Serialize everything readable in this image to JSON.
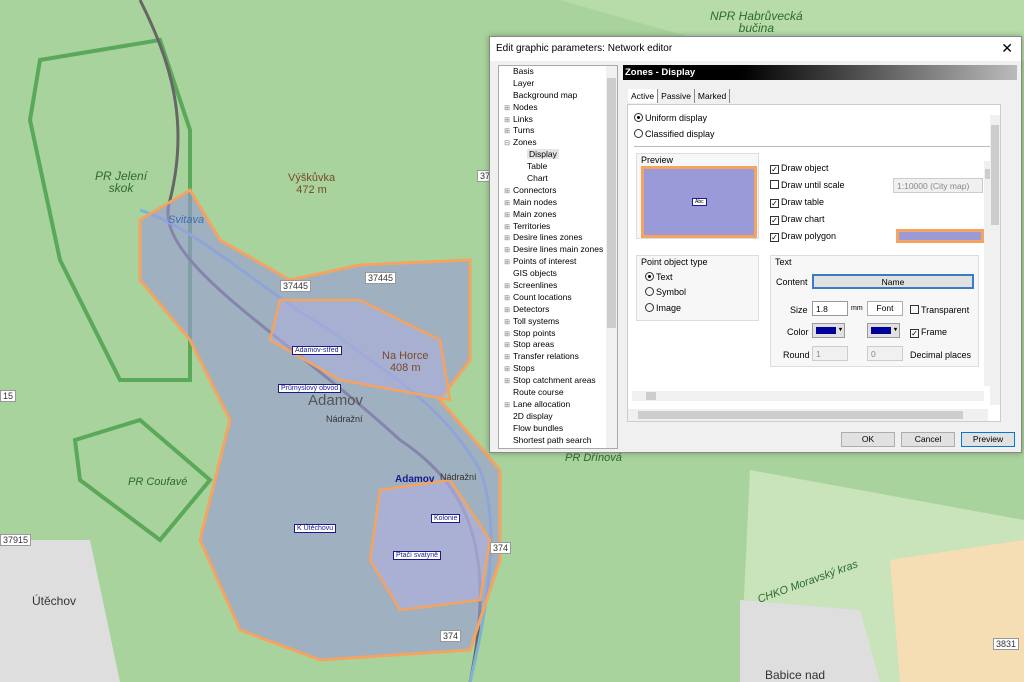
{
  "map": {
    "labels": {
      "npr": "NPR Habrůvecká",
      "npr2": "bučina",
      "jeleni": "PR Jelení",
      "jeleni2": "skok",
      "vyskuvka": "Výškůvka",
      "vyskuvka_h": "472 m",
      "svitava": "Svitava",
      "nahorce": "Na Horce",
      "nahorce_h": "408 m",
      "adamov_big": "Adamov",
      "nadrazni": "Nádražní",
      "nadrazni2": "Nádražní",
      "coufave": "PR Coufavé",
      "adamov2": "Adamov",
      "drinova": "PR Dřínová",
      "chko": "CHKO Moravský kras",
      "utechov": "Útěchov",
      "babice": "Babice nad"
    },
    "roads": {
      "r1": "37445",
      "r2": "37445",
      "r3": "374",
      "r4": "374",
      "r5": "37915",
      "r6": "3831",
      "r7": "15",
      "r8": "37"
    },
    "zones": {
      "z1": "Adamov-střed",
      "z2": "Průmyslový obvod",
      "z3": "K Útěchovu",
      "z4": "Kolonie",
      "z5": "Ptačí svatyně"
    },
    "colors": {
      "zone_fill": "#9a9ad8",
      "zone_border": "#f4a460",
      "forest": "#a9d39c"
    }
  },
  "dialog": {
    "title": "Edit graphic parameters: Network editor",
    "tree": [
      {
        "label": "Basis",
        "exp": ""
      },
      {
        "label": "Layer",
        "exp": ""
      },
      {
        "label": "Background map",
        "exp": ""
      },
      {
        "label": "Nodes",
        "exp": "+"
      },
      {
        "label": "Links",
        "exp": "+"
      },
      {
        "label": "Turns",
        "exp": "+"
      },
      {
        "label": "Zones",
        "exp": "-"
      },
      {
        "label": "Display",
        "exp": "",
        "child": true,
        "selected": true
      },
      {
        "label": "Table",
        "exp": "",
        "child": true
      },
      {
        "label": "Chart",
        "exp": "",
        "child": true
      },
      {
        "label": "Connectors",
        "exp": "+"
      },
      {
        "label": "Main nodes",
        "exp": "+"
      },
      {
        "label": "Main zones",
        "exp": "+"
      },
      {
        "label": "Territories",
        "exp": "+"
      },
      {
        "label": "Desire lines zones",
        "exp": "+"
      },
      {
        "label": "Desire lines main zones",
        "exp": "+"
      },
      {
        "label": "Points of interest",
        "exp": "+"
      },
      {
        "label": "GIS objects",
        "exp": ""
      },
      {
        "label": "Screenlines",
        "exp": "+"
      },
      {
        "label": "Count locations",
        "exp": "+"
      },
      {
        "label": "Detectors",
        "exp": "+"
      },
      {
        "label": "Toll systems",
        "exp": "+"
      },
      {
        "label": "Stop points",
        "exp": "+"
      },
      {
        "label": "Stop areas",
        "exp": "+"
      },
      {
        "label": "Transfer relations",
        "exp": "+"
      },
      {
        "label": "Stops",
        "exp": "+"
      },
      {
        "label": "Stop catchment areas",
        "exp": "+"
      },
      {
        "label": "Route course",
        "exp": ""
      },
      {
        "label": "Lane allocation",
        "exp": "+"
      },
      {
        "label": "2D display",
        "exp": ""
      },
      {
        "label": "Flow bundles",
        "exp": ""
      },
      {
        "label": "Shortest path search",
        "exp": ""
      }
    ],
    "header": "Zones - Display",
    "tabs": [
      "Active",
      "Passive",
      "Marked"
    ],
    "uniform": "Uniform display",
    "classified": "Classified display",
    "preview_label": "Preview",
    "preview_text": "Abc",
    "draw_object": "Draw object",
    "draw_until_scale": "Draw until scale",
    "scale_value": "1:10000 (City map)",
    "draw_table": "Draw table",
    "draw_chart": "Draw chart",
    "draw_polygon": "Draw polygon",
    "point_type": "Point object type",
    "pt_text": "Text",
    "pt_symbol": "Symbol",
    "pt_image": "Image",
    "text_group": "Text",
    "content_label": "Content",
    "content_value": "Name",
    "size_label": "Size",
    "size_value": "1.8",
    "size_unit": "mm",
    "font_btn": "Font",
    "transparent": "Transparent",
    "color_label": "Color",
    "text_color": "#000098",
    "frame_color": "#000098",
    "frame": "Frame",
    "round_label": "Round",
    "round_value": "1",
    "decimals_value": "0",
    "decimal_places": "Decimal places",
    "ok": "OK",
    "cancel": "Cancel",
    "preview_btn": "Preview"
  }
}
